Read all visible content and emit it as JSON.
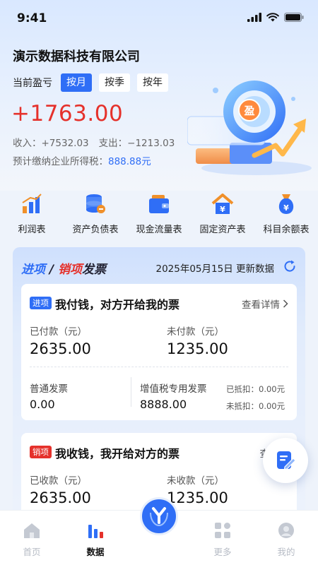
{
  "status": {
    "time": "9:41"
  },
  "company": "演示数据科技有限公司",
  "period": {
    "label": "当前盈亏",
    "options": [
      "按月",
      "按季",
      "按年"
    ],
    "selected": "按月"
  },
  "summary": {
    "profit": "+1763.00",
    "income_label": "收入：",
    "income": "+7532.03",
    "expense_label": "支出：",
    "expense": "−1213.03",
    "tax_label": "预计缴纳企业所得税：",
    "tax": "888.88元",
    "hero_badge": "盈"
  },
  "menu": [
    {
      "label": "利润表",
      "icon": "bar-chart-icon"
    },
    {
      "label": "资产负债表",
      "icon": "database-icon"
    },
    {
      "label": "现金流量表",
      "icon": "wallet-icon"
    },
    {
      "label": "固定资产表",
      "icon": "house-yen-icon"
    },
    {
      "label": "科目余额表",
      "icon": "money-bag-icon"
    }
  ],
  "invoice": {
    "title_in": "进项",
    "title_sep": " / ",
    "title_out": "销项",
    "title_rest": "发票",
    "date": "2025年05月15日",
    "update_label": "更新数据",
    "incoming": {
      "tag": "进项",
      "title": "我付钱，对方开给我的票",
      "link": "查看详情",
      "paid_label": "已付款（元）",
      "paid": "2635.00",
      "unpaid_label": "未付款（元）",
      "unpaid": "1235.00",
      "normal_label": "普通发票",
      "normal": "0.00",
      "vat_label": "增值税专用发票",
      "vat": "8888.00",
      "deducted_label": "已抵扣：",
      "deducted": "0.00元",
      "undeducted_label": "未抵扣：",
      "undeducted": "0.00元"
    },
    "outgoing": {
      "tag": "销项",
      "title": "我收钱，我开给对方的票",
      "link": "查看详",
      "received_label": "已收款（元）",
      "received": "2635.00",
      "unreceived_label": "未收款（元）",
      "unreceived": "1235.00"
    }
  },
  "tabs": [
    {
      "label": "首页",
      "icon": "home-icon",
      "active": false
    },
    {
      "label": "数据",
      "icon": "chart-icon",
      "active": true
    },
    {
      "label": "更多",
      "icon": "grid-icon",
      "active": false
    },
    {
      "label": "我的",
      "icon": "profile-icon",
      "active": false
    }
  ],
  "colors": {
    "accent": "#2f6ef6",
    "profit": "#e5312b"
  }
}
